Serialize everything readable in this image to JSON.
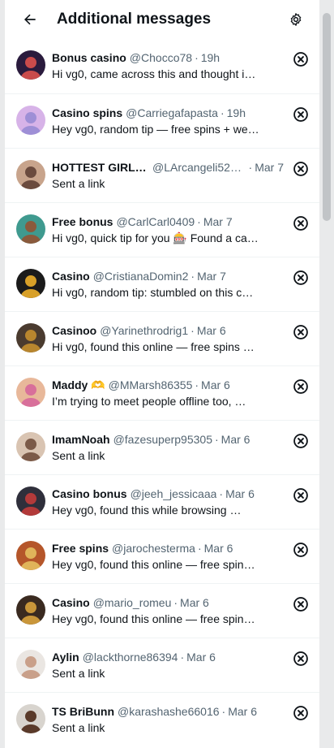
{
  "header": {
    "title": "Additional messages",
    "back_icon": "back-arrow-icon",
    "settings_icon": "gear-icon"
  },
  "messages": [
    {
      "name": "Bonus casino",
      "handle": "@Chocco78",
      "time": "19h",
      "snippet": "Hi vg0, came across this and thought i…",
      "avatar_colors": [
        "#2a1b3d",
        "#c94b4b"
      ]
    },
    {
      "name": "Casino spins",
      "handle": "@Carriegafapasta",
      "time": "19h",
      "snippet": "Hey vg0, random tip — free spins + we…",
      "avatar_colors": [
        "#d7b3e8",
        "#9e8fd6"
      ]
    },
    {
      "name": "HOTTEST GIRLS…",
      "handle": "@LArcangeli522…",
      "time": "Mar 7",
      "snippet": "Sent a link",
      "avatar_colors": [
        "#c8a48c",
        "#6b4b3e"
      ]
    },
    {
      "name": "Free bonus",
      "handle": "@CarlCarl0409",
      "time": "Mar 7",
      "snippet": "Hi vg0, quick tip for you 🎰 Found a ca…",
      "avatar_colors": [
        "#3f9a8f",
        "#8a5a3c"
      ]
    },
    {
      "name": "Casino",
      "handle": "@CristianaDomin2",
      "time": "Mar 7",
      "snippet": "Hi vg0, random tip: stumbled on this c…",
      "avatar_colors": [
        "#1b1b1b",
        "#d8a028"
      ]
    },
    {
      "name": "Casinoo",
      "handle": "@Yarinethrodrig1",
      "time": "Mar 6",
      "snippet": "Hi vg0, found this online — free spins …",
      "avatar_colors": [
        "#4a3b2f",
        "#b8862e"
      ]
    },
    {
      "name": "Maddy 🫶",
      "handle": "@MMarsh86355",
      "time": "Mar 6",
      "snippet": "I’m trying to meet people offline too, …",
      "avatar_colors": [
        "#e8b89a",
        "#d86f9a"
      ]
    },
    {
      "name": "ImamNoah",
      "handle": "@fazesuperp95305",
      "time": "Mar 6",
      "snippet": "Sent a link",
      "avatar_colors": [
        "#d9c4b2",
        "#7b5a48"
      ]
    },
    {
      "name": "Casino bonus",
      "handle": "@jeeh_jessicaaa",
      "time": "Mar 6",
      "snippet": "Hey vg0, found this while browsing …",
      "avatar_colors": [
        "#2f2f3b",
        "#b33a3a"
      ]
    },
    {
      "name": "Free spins",
      "handle": "@jarochesterma",
      "time": "Mar 6",
      "snippet": "Hey vg0, found this online — free spin…",
      "avatar_colors": [
        "#b5562a",
        "#e0b45a"
      ]
    },
    {
      "name": "Casino",
      "handle": "@mario_romeu",
      "time": "Mar 6",
      "snippet": "Hey vg0, found this online — free spin…",
      "avatar_colors": [
        "#3a2a20",
        "#c9963a"
      ]
    },
    {
      "name": "Aylin",
      "handle": "@lackthorne86394",
      "time": "Mar 6",
      "snippet": "Sent a link",
      "avatar_colors": [
        "#eae6e2",
        "#c9a08a"
      ]
    },
    {
      "name": "TS BriBunn",
      "handle": "@karashashe66016",
      "time": "Mar 6",
      "snippet": "Sent a link",
      "avatar_colors": [
        "#d8d4ce",
        "#5a3a2a"
      ]
    }
  ],
  "row_close_icon": "close-circle-icon",
  "separator": "·"
}
